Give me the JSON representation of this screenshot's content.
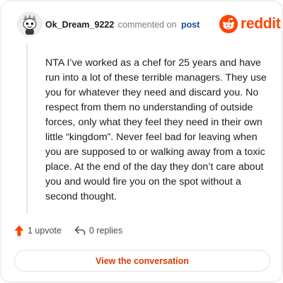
{
  "header": {
    "username": "Ok_Dream_9222",
    "commented_on": "commented on",
    "post_link": "post",
    "brand": "reddit"
  },
  "comment": {
    "text": "NTA I’ve worked as a chef for 25 years and have run into a lot of these terrible managers. They use you for whatever they need and discard you. No respect from them no understanding of outside forces, only what they feel they need in their own little “kingdom”. Never feel bad for leaving when you are supposed to or walking away from a toxic place. At the end of the day they don’t care about you and would fire you on the spot without a second thought."
  },
  "actions": {
    "upvotes": "1 upvote",
    "replies": "0 replies"
  },
  "cta": {
    "label": "View the conversation"
  },
  "icons": {
    "avatar": "snoo-avatar-icon",
    "logo": "reddit-logo-icon",
    "upvote": "upvote-arrow-icon",
    "reply": "reply-arrow-icon"
  },
  "colors": {
    "brand_orange": "#ff4500",
    "upvote_orange": "#ff4500",
    "link_blue": "#1a4fa0",
    "cta_text": "#d93a00"
  }
}
